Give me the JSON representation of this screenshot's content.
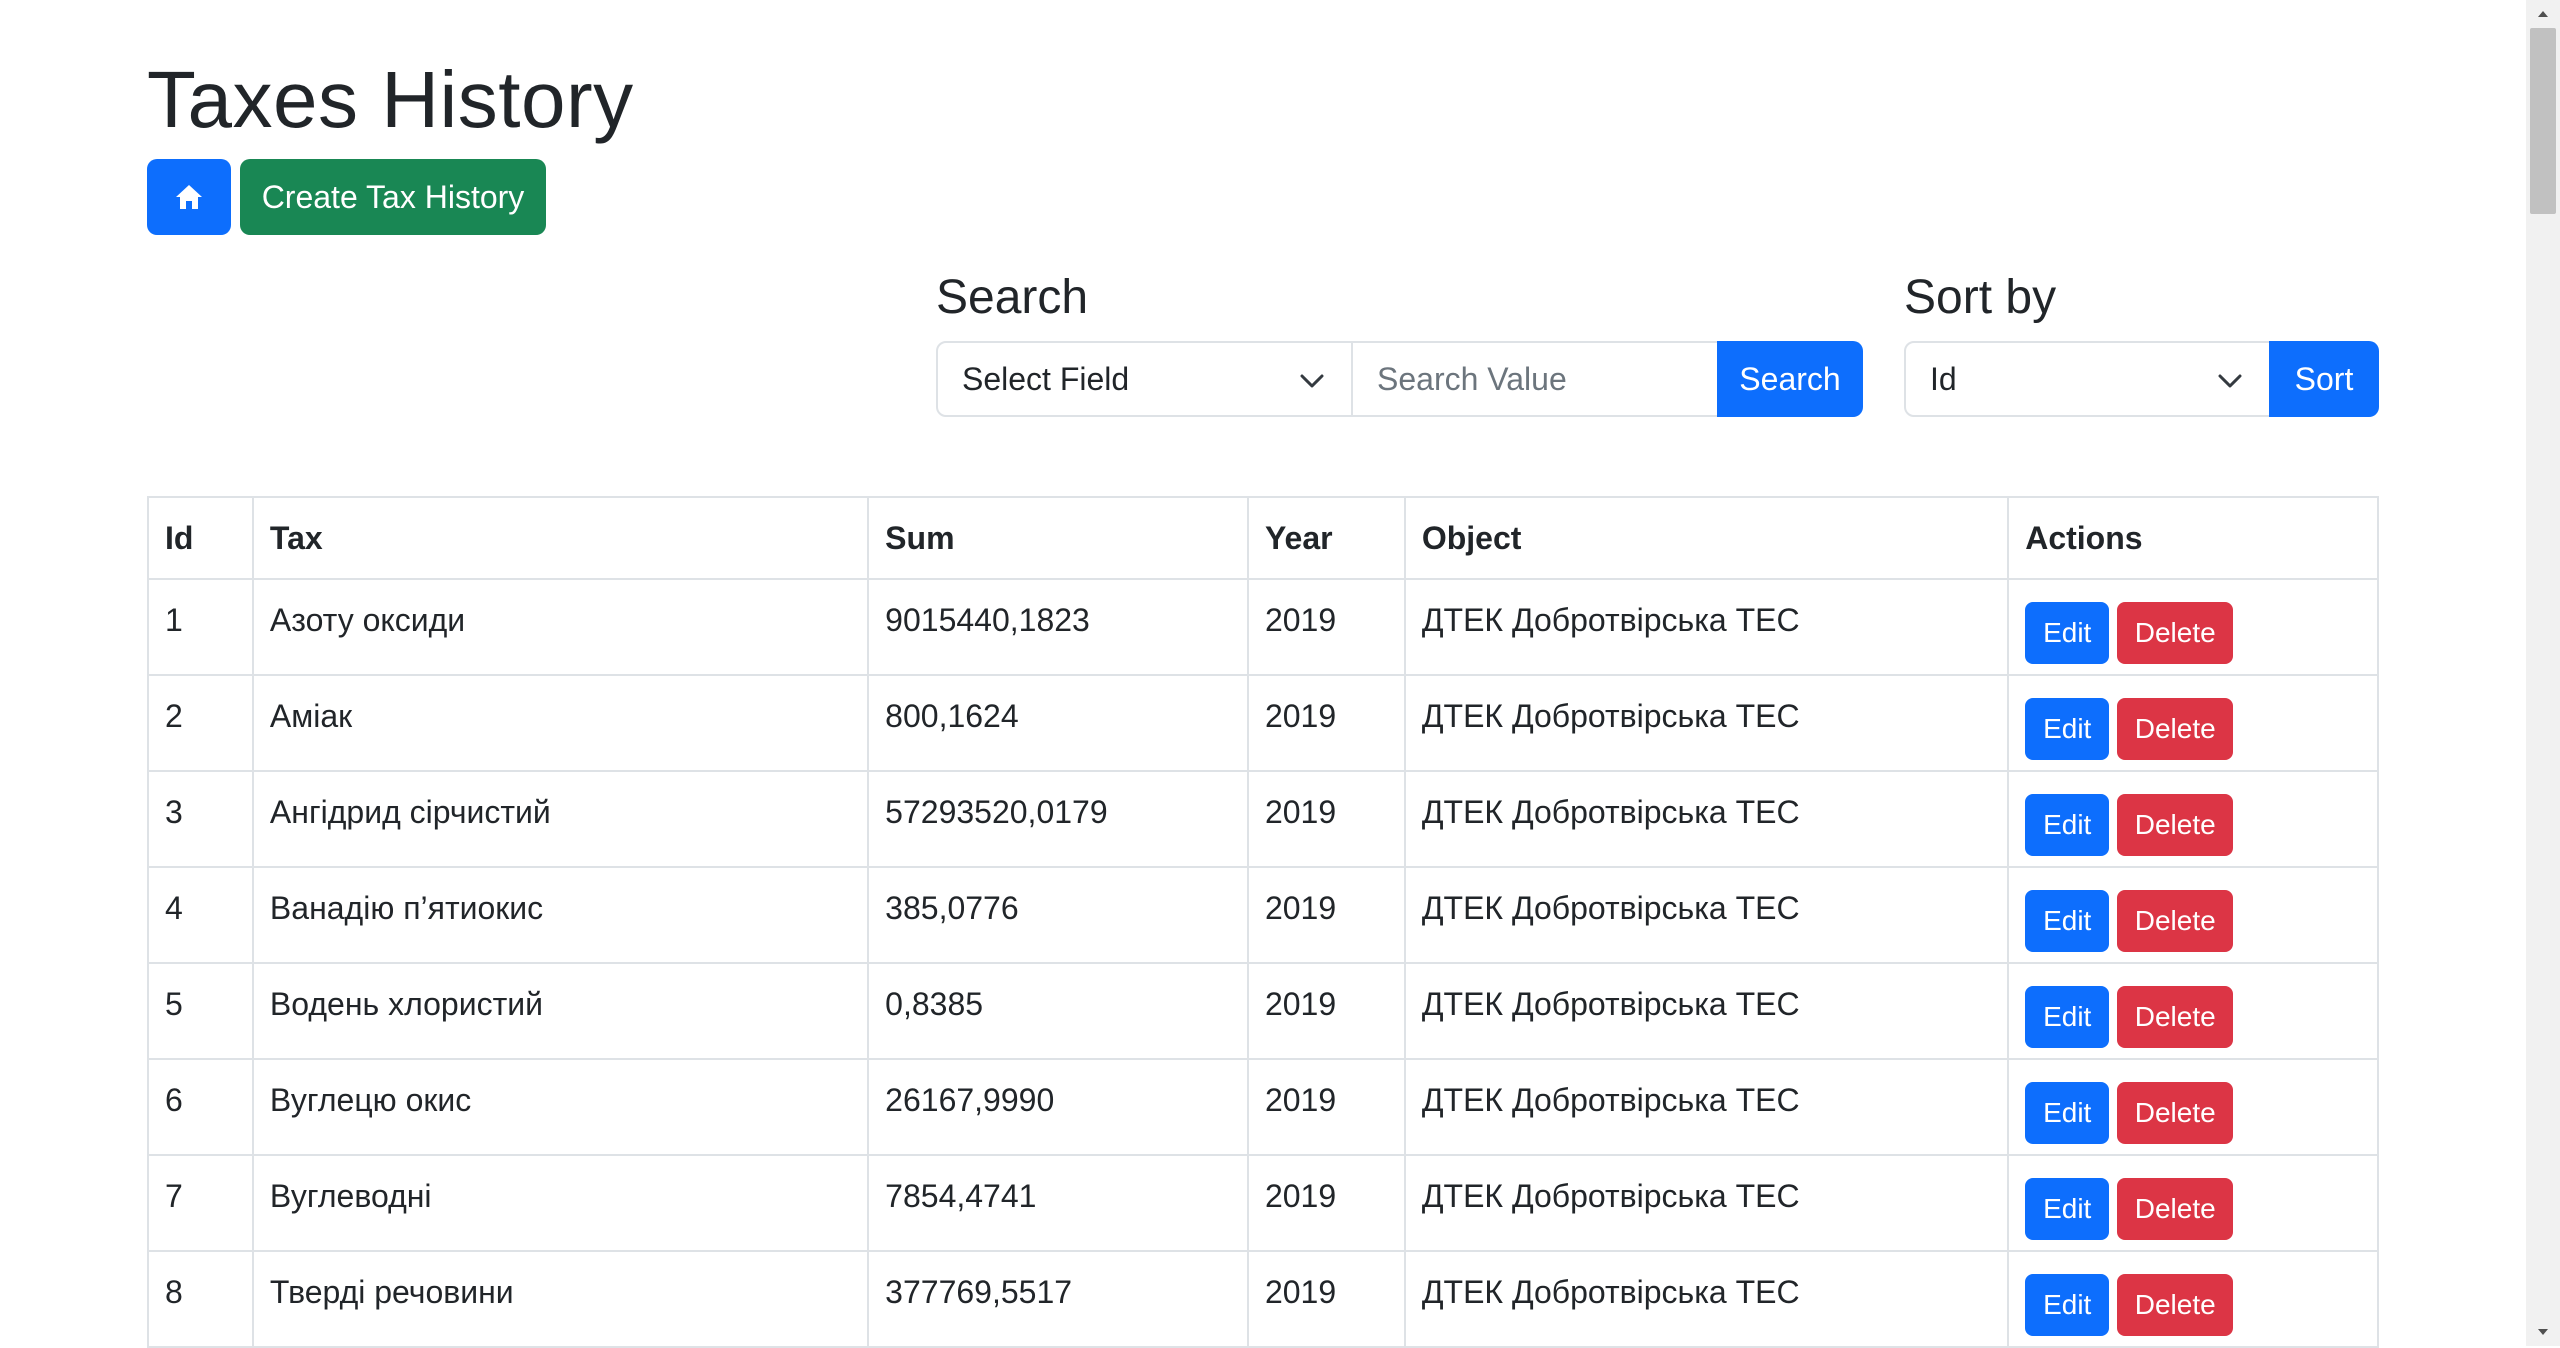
{
  "page_title": "Taxes History",
  "toolbar": {
    "home_icon": "home-icon",
    "create_label": "Create Tax History"
  },
  "search": {
    "heading": "Search",
    "field_select_value": "Select Field",
    "value_placeholder": "Search Value",
    "button_label": "Search"
  },
  "sort": {
    "heading": "Sort by",
    "select_value": "Id",
    "button_label": "Sort"
  },
  "table": {
    "columns": [
      "Id",
      "Tax",
      "Sum",
      "Year",
      "Object",
      "Actions"
    ],
    "rows": [
      {
        "id": "1",
        "tax": "Азоту оксиди",
        "sum": "9015440,1823",
        "year": "2019",
        "object": "ДТЕК Добротвірська ТЕС"
      },
      {
        "id": "2",
        "tax": "Аміак",
        "sum": "800,1624",
        "year": "2019",
        "object": "ДТЕК Добротвірська ТЕС"
      },
      {
        "id": "3",
        "tax": "Ангідрид сірчистий",
        "sum": "57293520,0179",
        "year": "2019",
        "object": "ДТЕК Добротвірська ТЕС"
      },
      {
        "id": "4",
        "tax": "Ванадію п’ятиокис",
        "sum": "385,0776",
        "year": "2019",
        "object": "ДТЕК Добротвірська ТЕС"
      },
      {
        "id": "5",
        "tax": "Водень хлористий",
        "sum": "0,8385",
        "year": "2019",
        "object": "ДТЕК Добротвірська ТЕС"
      },
      {
        "id": "6",
        "tax": "Вуглецю окис",
        "sum": "26167,9990",
        "year": "2019",
        "object": "ДТЕК Добротвірська ТЕС"
      },
      {
        "id": "7",
        "tax": "Вуглеводні",
        "sum": "7854,4741",
        "year": "2019",
        "object": "ДТЕК Добротвірська ТЕС"
      },
      {
        "id": "8",
        "tax": "Тверді речовини",
        "sum": "377769,5517",
        "year": "2019",
        "object": "ДТЕК Добротвірська ТЕС"
      }
    ],
    "edit_label": "Edit",
    "delete_label": "Delete"
  },
  "colors": {
    "primary": "#0d6efd",
    "success": "#198754",
    "danger": "#dc3545"
  }
}
